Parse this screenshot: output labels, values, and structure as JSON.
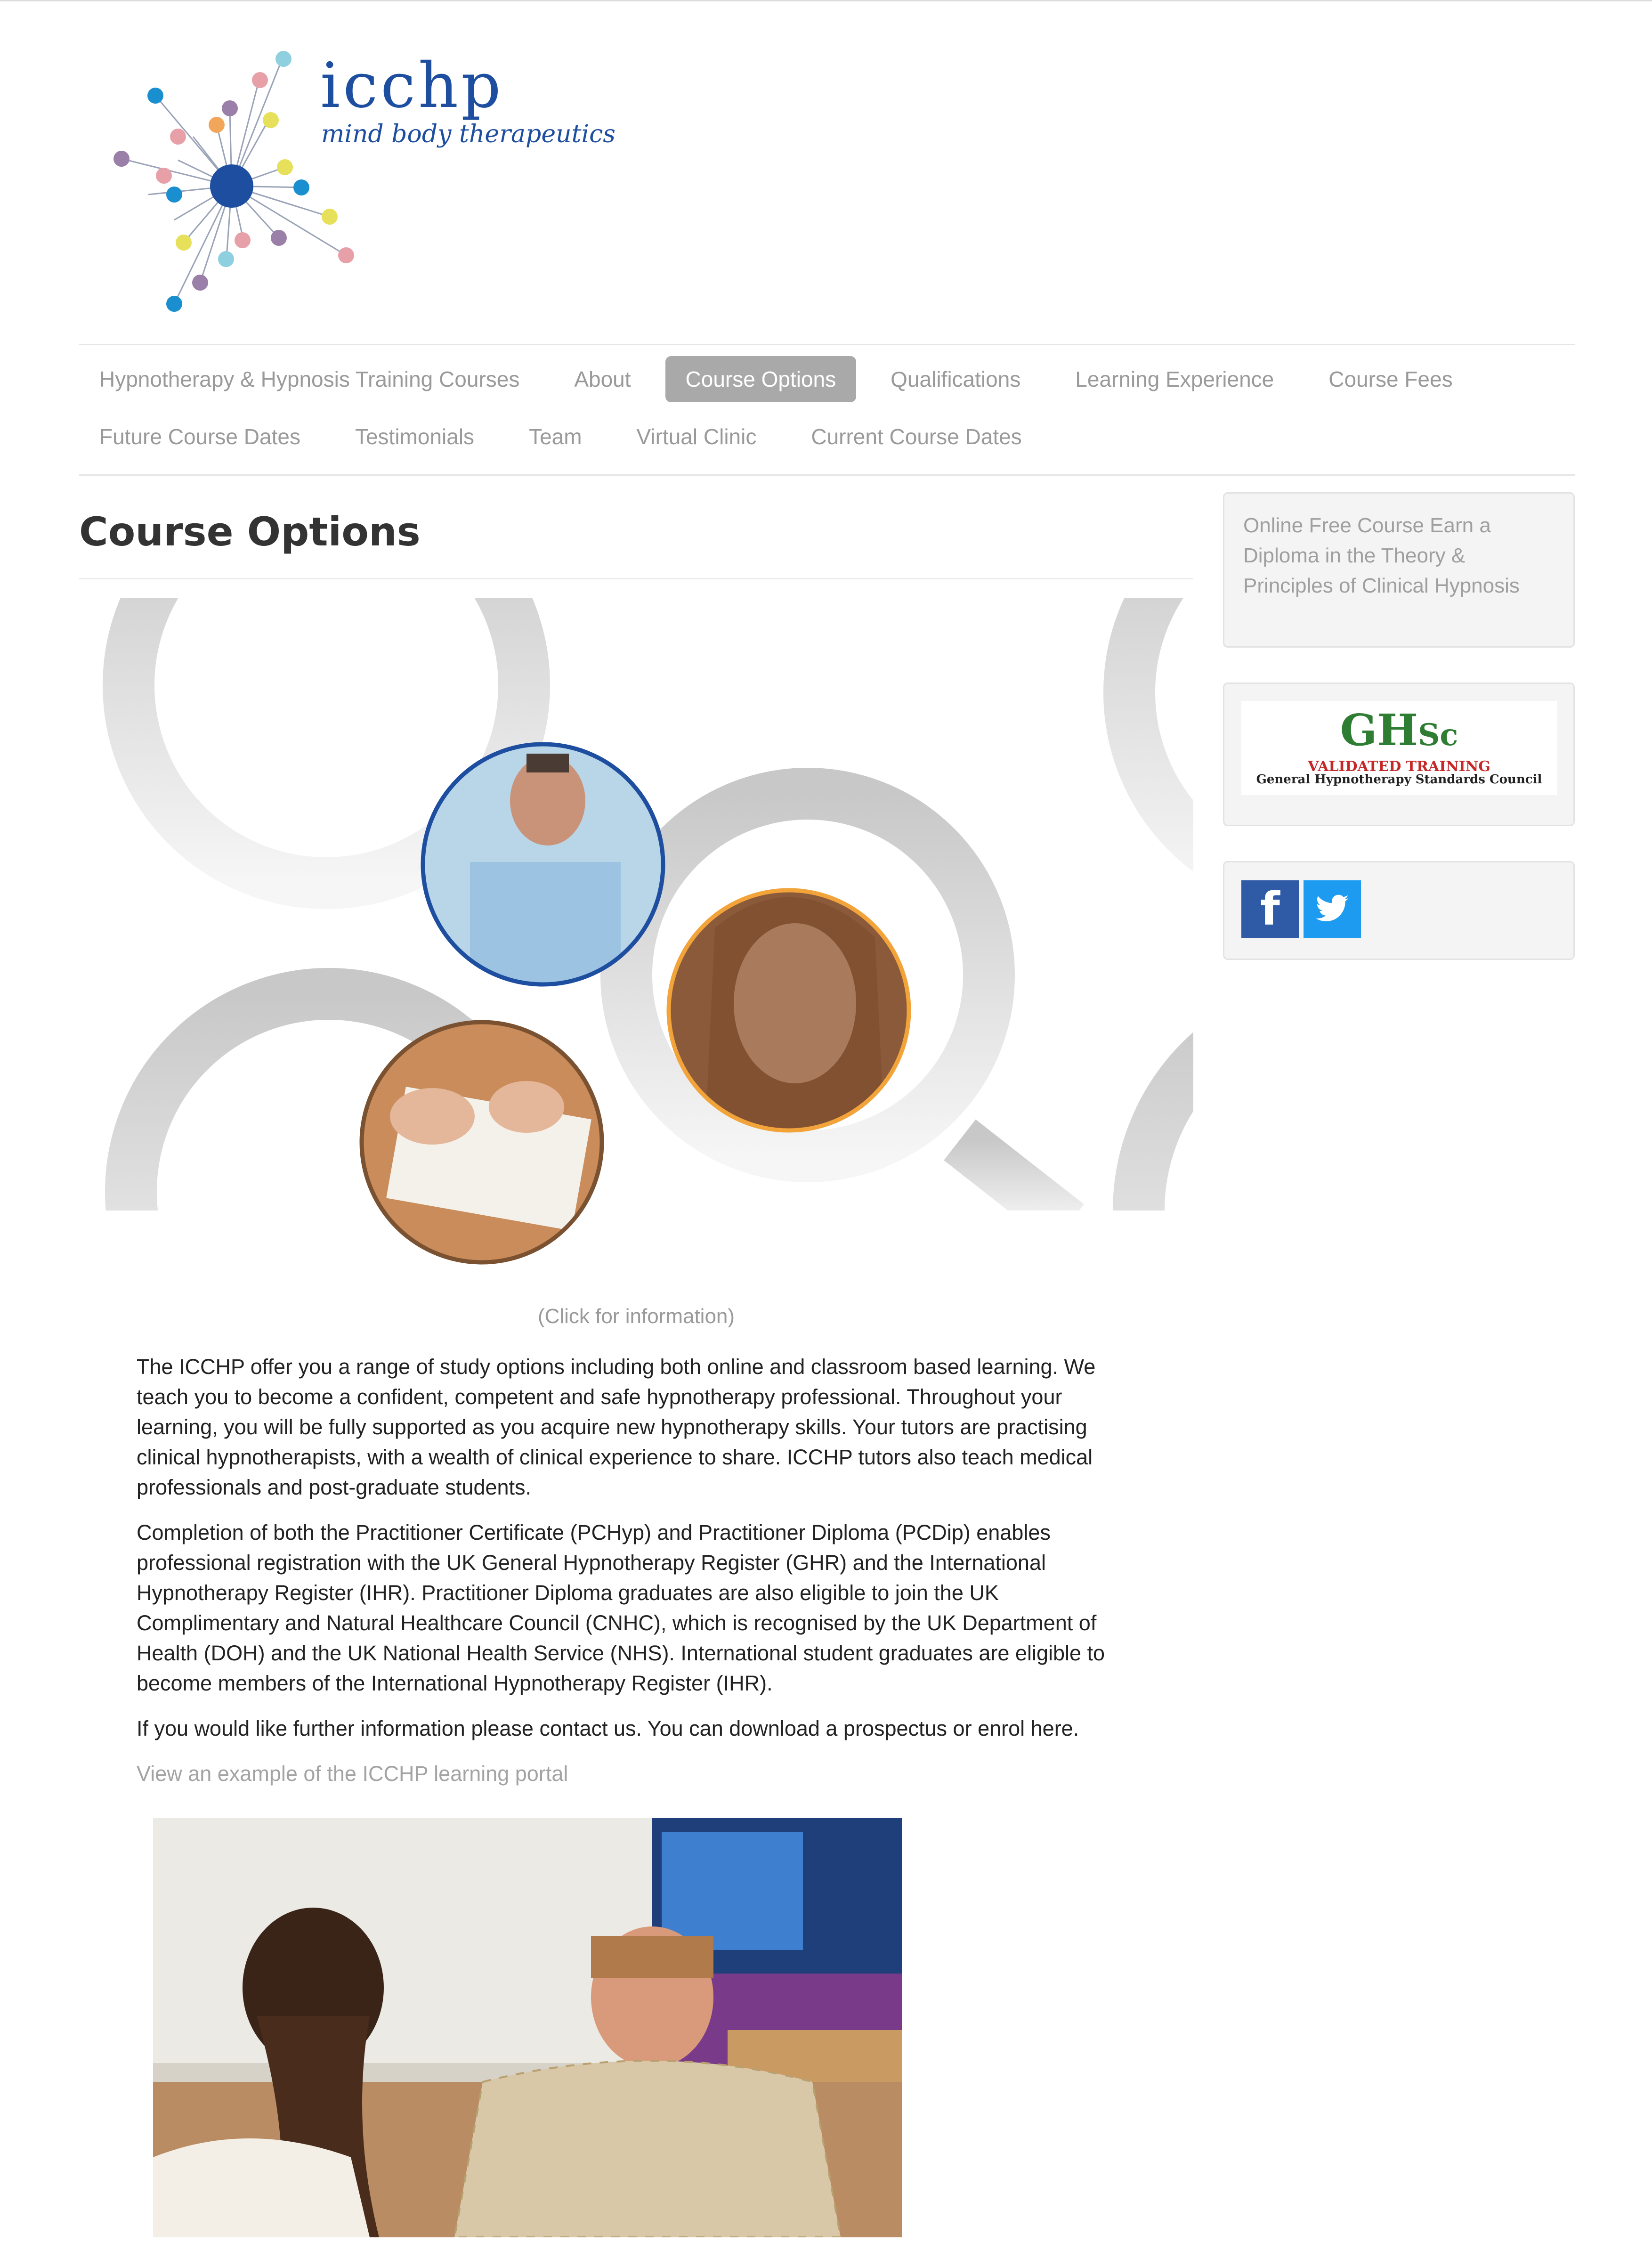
{
  "logo": {
    "name": "icchp",
    "tagline": "mind body therapeutics"
  },
  "nav": {
    "row1": [
      {
        "label": "Hypnotherapy & Hypnosis Training Courses",
        "active": false
      },
      {
        "label": "About",
        "active": false
      },
      {
        "label": "Course Options",
        "active": true
      },
      {
        "label": "Qualifications",
        "active": false
      },
      {
        "label": "Learning Experience",
        "active": false
      },
      {
        "label": "Course Fees",
        "active": false
      }
    ],
    "row2": [
      {
        "label": "Future Course Dates",
        "active": false
      },
      {
        "label": "Testimonials",
        "active": false
      },
      {
        "label": "Team",
        "active": false
      },
      {
        "label": "Virtual Clinic",
        "active": false
      },
      {
        "label": "Current Course Dates",
        "active": false
      }
    ]
  },
  "main": {
    "title": "Course Options",
    "caption": "(Click for information)",
    "paragraphs": [
      "The ICCHP offer you a range of study options including both online and classroom based learning. We teach you to become a confident, competent and safe hypnotherapy professional. Throughout your learning, you will be fully supported as you acquire new hypnotherapy skills. Your tutors are practising clinical hypnotherapists, with a wealth of clinical experience to share. ICCHP tutors also teach medical professionals and post-graduate students.",
      "Completion of both the Practitioner Certificate (PCHyp) and Practitioner Diploma (PCDip) enables professional registration with the UK General Hypnotherapy Register (GHR) and the International Hypnotherapy Register (IHR). Practitioner Diploma graduates are also eligible to join the UK Complimentary and Natural Healthcare Council (CNHC), which is recognised by the UK Department of Health (DOH) and the UK National Health Service (NHS). International student graduates are eligible to become members of the International Hypnotherapy Register (IHR).",
      "If you would like further information please contact us. You can download a prospectus or enrol here."
    ],
    "portal_link": "View an example of the ICCHP learning portal"
  },
  "sidebar": {
    "promo": "Online Free Course Earn a Diploma in the Theory & Principles of Clinical Hypnosis",
    "ghsc": {
      "letters": "GH",
      "letters_small": "Sc",
      "validated": "VALIDATED TRAINING",
      "council": "General Hypnotherapy Standards Council"
    },
    "social": {
      "facebook": "f",
      "twitter_icon": "twitter-bird"
    }
  },
  "colors": {
    "brand_blue": "#1e4ea0",
    "nav_active_bg": "#a9a9a9",
    "facebook": "#2f5aa6",
    "twitter": "#1d9bf0"
  }
}
